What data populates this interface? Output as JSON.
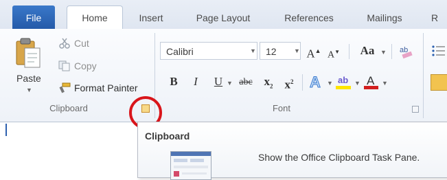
{
  "tabs": {
    "file": "File",
    "home": "Home",
    "insert": "Insert",
    "page_layout": "Page Layout",
    "references": "References",
    "mailings": "Mailings",
    "overflow": "R"
  },
  "clipboard": {
    "paste": "Paste",
    "cut": "Cut",
    "copy": "Copy",
    "format_painter": "Format Painter",
    "group_label": "Clipboard"
  },
  "font": {
    "font_name": "Calibri",
    "font_size": "12",
    "grow": "A",
    "shrink": "A",
    "change_case": "Aa",
    "bold": "B",
    "italic": "I",
    "underline": "U",
    "strikethrough": "abc",
    "subscript": "x",
    "superscript": "x",
    "group_label": "Font"
  },
  "tooltip": {
    "title": "Clipboard",
    "body": "Show the Office Clipboard Task Pane."
  },
  "colors": {
    "file_tab": "#2a62b4",
    "highlight_circle": "#d9151b",
    "font_color_bar": "#d21f1f",
    "highlight_bar": "#ffe500"
  }
}
